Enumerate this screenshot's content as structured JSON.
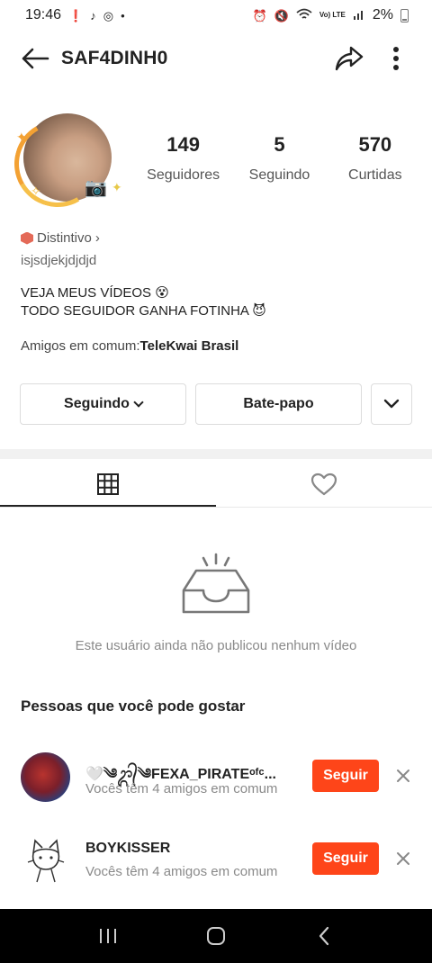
{
  "status_bar": {
    "time": "19:46",
    "battery": "2%",
    "network": "Vo) LTE"
  },
  "header": {
    "username": "SAF4DINH0"
  },
  "profile": {
    "stats": [
      {
        "value": "149",
        "label": "Seguidores"
      },
      {
        "value": "5",
        "label": "Seguindo"
      },
      {
        "value": "570",
        "label": "Curtidas"
      }
    ],
    "badge_label": "Distintivo",
    "handle": "isjsdjekjdjdjd",
    "bio_line1": "VEJA MEUS VÍDEOS 😵",
    "bio_line2": "TODO SEGUIDOR GANHA FOTINHA 😈",
    "friends_prefix": "Amigos em comum:",
    "friends_name": "TeleKwai Brasil"
  },
  "actions": {
    "following_label": "Seguindo",
    "chat_label": "Bate-papo"
  },
  "empty_state": {
    "text": "Este usuário ainda não publicou nenhum vídeo"
  },
  "suggestions": {
    "title": "Pessoas que você pode gostar",
    "items": [
      {
        "name": "🤍༄ᬊ᭄༄FEXA_PIRATEᵒᶠᶜ...",
        "sub": "Vocês têm 4 amigos em comum",
        "button": "Seguir"
      },
      {
        "name": "BOYKISSER",
        "sub": "Vocês têm 4 amigos em comum",
        "button": "Seguir"
      }
    ]
  },
  "colors": {
    "accent": "#fe4519",
    "text": "#222222",
    "muted": "#8a8a8a"
  }
}
